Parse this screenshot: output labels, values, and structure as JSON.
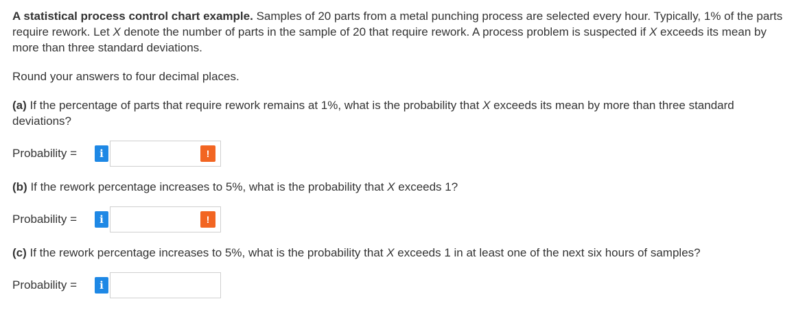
{
  "intro": {
    "bold_title": "A statistical process control chart example.",
    "text_1": " Samples of 20 parts from a metal punching process are selected every hour. Typically, 1% of the parts require rework. Let ",
    "var_x": "X",
    "text_2": " denote the number of parts in the sample of 20 that require rework. A process problem is suspected if ",
    "var_x_2": "X",
    "text_3": " exceeds its mean by more than three standard deviations."
  },
  "round_note": "Round your answers to four decimal places.",
  "questions": [
    {
      "label": "(a)",
      "text_1": " If the percentage of parts that require rework remains at 1%, what is the probability that ",
      "var": "X",
      "text_2": " exceeds its mean by more than three standard deviations?",
      "answer_label": "Probability =",
      "info_icon": "i",
      "answer_value": "",
      "warning_icon": "!"
    },
    {
      "label": "(b)",
      "text_1": " If the rework percentage increases to 5%, what is the probability that ",
      "var": "X",
      "text_2": " exceeds 1?",
      "answer_label": "Probability =",
      "info_icon": "i",
      "answer_value": "",
      "warning_icon": "!"
    },
    {
      "label": "(c)",
      "text_1": " If the rework percentage increases to 5%, what is the probability that ",
      "var": "X",
      "text_2": " exceeds 1 in at least one of the next six hours of samples?",
      "answer_label": "Probability =",
      "info_icon": "i",
      "answer_value": ""
    }
  ],
  "colors": {
    "info": "#1e88e5",
    "warning": "#f26522",
    "text": "#333333"
  }
}
